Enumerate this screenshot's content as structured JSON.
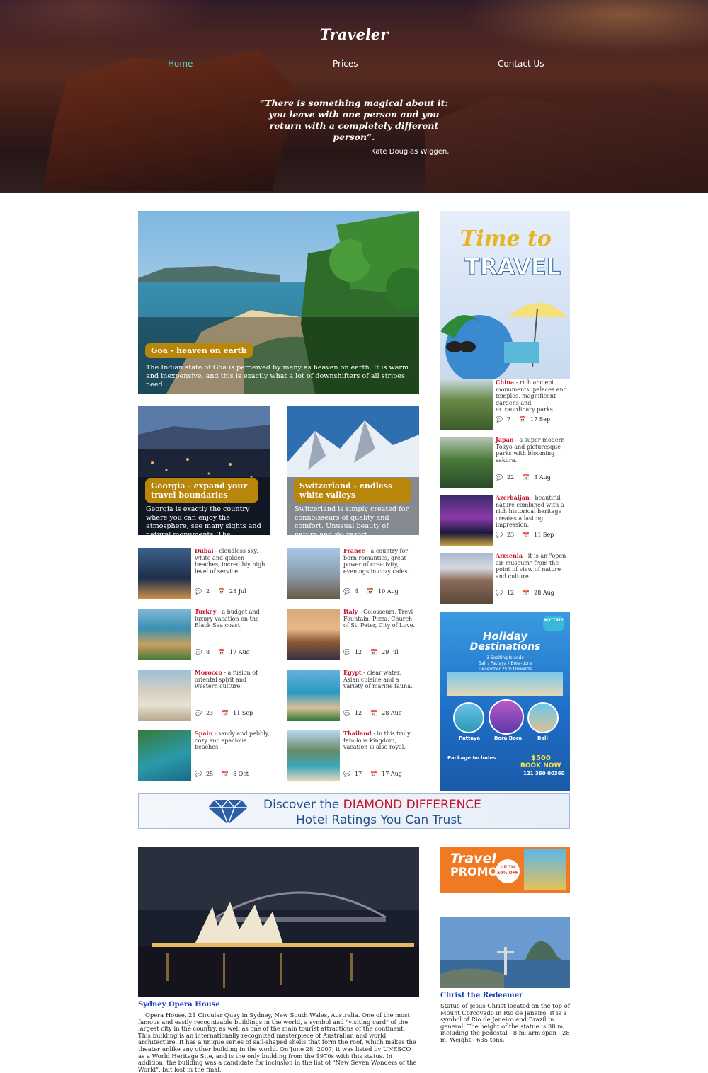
{
  "header": {
    "brand": "Traveler",
    "nav": [
      {
        "label": "Home",
        "active": true
      },
      {
        "label": "Prices",
        "active": false
      },
      {
        "label": "Contact Us",
        "active": false
      }
    ],
    "quote": "“There is something magical about it: you leave with one person and you return with a completely different person”.",
    "quote_author": "Kate Douglas Wiggen."
  },
  "featured": {
    "title": "Goa - heaven on earth",
    "text": "The Indian state of Goa is perceived by many as heaven on earth. It is warm and inexpensive, and this is exactly what a lot of downshifters of all stripes need."
  },
  "secondary": [
    {
      "title": "Georgia - expand your travel boundaries",
      "text": "Georgia is exactly the country where you can enjoy the atmosphere, see many sights and natural monuments. The…"
    },
    {
      "title": "Switzerland - endless white valleys",
      "text": "Switzerland is simply created for connoisseurs of quality and comfort. Unusual beauty of nature and ski resort…"
    }
  ],
  "list_left": [
    {
      "name": "Dubai",
      "text": " - cloudless sky, white and golden beaches, incredibly high level of service.",
      "comments": "2",
      "date": "28 Jul"
    },
    {
      "name": "Turkey",
      "text": " - a budget and luxury vacation on the Black Sea coast.",
      "comments": "8",
      "date": "17 Aug"
    },
    {
      "name": "Morocco",
      "text": " - a fusion of oriental spirit and western culture.",
      "comments": "23",
      "date": "11 Sep"
    },
    {
      "name": "Spain",
      "text": " - sandy and pebbly, cozy and spacious beaches.",
      "comments": "25",
      "date": "8 Oct"
    }
  ],
  "list_right": [
    {
      "name": "France",
      "text": " - a country for born romantics, great power of creativity, evenings in cozy cafes.",
      "comments": "4",
      "date": "10 Aug"
    },
    {
      "name": "Italy",
      "text": " - Colosseum, Trevi Fountain, Pizza, Church of St. Peter, City of Love.",
      "comments": "12",
      "date": "29 Jul"
    },
    {
      "name": "Egypt",
      "text": " - clear water, Asian cuisine and a variety of marine fauna.",
      "comments": "12",
      "date": "28 Aug"
    },
    {
      "name": "Thailand",
      "text": " - in this truly fabulous kingdom, vacation is also royal.",
      "comments": "17",
      "date": "17 Aug"
    }
  ],
  "sidebar_list": [
    {
      "name": "China",
      "text": " - rich ancient monuments, palaces and temples, magnificent gardens and extraordinary parks.",
      "comments": "7",
      "date": "17 Sep"
    },
    {
      "name": "Japan",
      "text": " - a super-modern Tokyo and picturesque parks with blooming sakura.",
      "comments": "22",
      "date": "3 Aug"
    },
    {
      "name": "Azerbaijan",
      "text": " - beautiful nature combined with a rich historical heritage creates a lasting impression.",
      "comments": "23",
      "date": "11 Sep"
    },
    {
      "name": "Armenia",
      "text": " - it is an \"open-air museum\" from the point of view of nature and culture.",
      "comments": "12",
      "date": "28 Aug"
    }
  ],
  "ads": {
    "time_to_travel": {
      "l1": "Time to",
      "l2": "TRAVEL"
    },
    "holiday": {
      "badge": "MY TRIP",
      "title1": "Holiday",
      "title2": "Destinations",
      "sub": "3 Exciting Islands",
      "islands_line": "Bali / Pattaya / Bora-bora",
      "date_line": "December 25th Onwards",
      "islands": [
        "Pattaya",
        "Bora Bora",
        "Bali"
      ],
      "package": "Package Includes",
      "price": "$500",
      "book": "BOOK NOW",
      "phone": "121 360 00360"
    },
    "banner": {
      "pre": "Discover the ",
      "highlight": "DIAMOND DIFFERENCE",
      "line2": "Hotel Ratings You Can Trust"
    },
    "promo": {
      "l1": "Travel",
      "l2": "PROMO",
      "badge": "UP TO 50% OFF"
    }
  },
  "sydney": {
    "title": "Sydney Opera House",
    "text": "Opera House, 21 Circular Quay in Sydney, New South Wales, Australia. One of the most famous and easily recognizable buildings in the world, a symbol and \"visiting card\" of the largest city in the country, as well as one of the main tourist attractions of the continent. This building is an internationally recognized masterpiece of Australian and world architecture. It has a unique series of sail-shaped shells that form the roof, which makes the theater unlike any other building in the world. On June 28, 2007, it was listed by UNESCO as a World Heritage Site, and is the only building from the 1970s with this status. In addition, the building was a candidate for inclusion in the list of \"New Seven Wonders of the World\", but lost in the final."
  },
  "redeemer": {
    "title": "Christ the Redeemer",
    "text": "Statue of Jesus Christ located on the top of Mount Corcovado in Rio de Janeiro. It is a symbol of Rio de Janeiro and Brazil in general. The height of the statue is 38 m, including the pedestal - 8 m; arm span - 28 m. Weight - 635 tons."
  }
}
